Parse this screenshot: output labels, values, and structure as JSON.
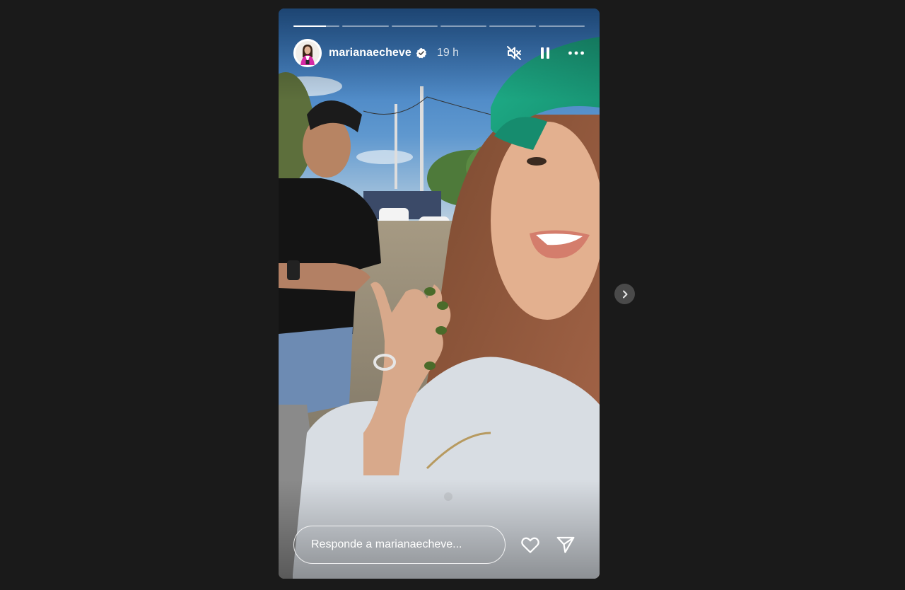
{
  "story": {
    "segments": 6,
    "active_index": 0,
    "active_progress": 0.7,
    "user": {
      "username": "marianaecheve",
      "verified": true,
      "time_ago": "19 h",
      "avatar_icon": "profile-avatar"
    },
    "controls": {
      "mute_icon": "muted-speaker-icon",
      "pause_icon": "pause-icon",
      "more_icon": "more-options-icon"
    },
    "reply_placeholder": "Responde a marianaecheve...",
    "like_icon": "heart-icon",
    "share_icon": "send-icon"
  },
  "navigation": {
    "next_icon": "chevron-right-icon"
  },
  "colors": {
    "background": "#1a1a1a",
    "verified_badge": "#ffffff",
    "cap_green": "#1eb28c"
  }
}
